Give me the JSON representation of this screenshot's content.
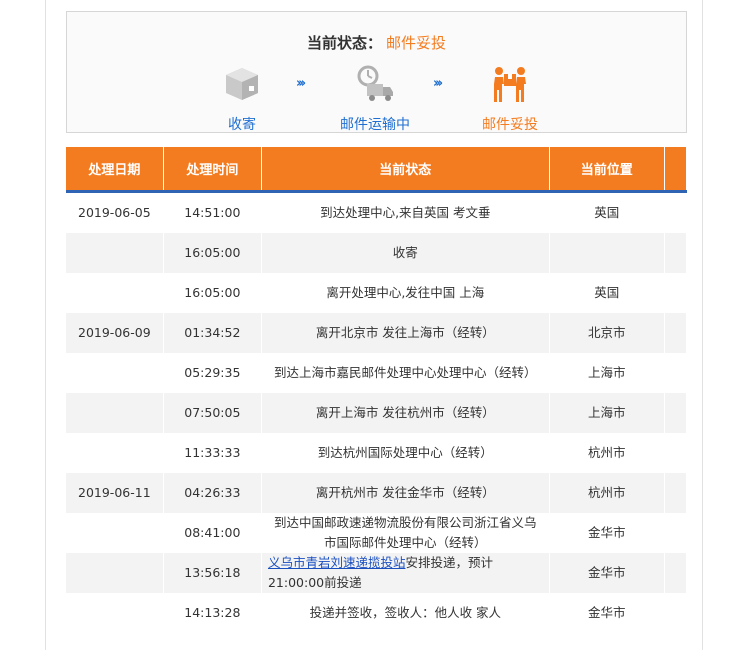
{
  "status": {
    "label": "当前状态：",
    "value": "邮件妥投",
    "steps": [
      {
        "label": "收寄",
        "icon": "package-box-icon",
        "color": "#1f6fd1"
      },
      {
        "label": "邮件运输中",
        "icon": "delivery-truck-icon",
        "color": "#1f6fd1"
      },
      {
        "label": "邮件妥投",
        "icon": "courier-delivery-icon",
        "color": "#f47c20"
      }
    ],
    "arrow": "›››"
  },
  "table": {
    "headers": [
      "处理日期",
      "处理时间",
      "当前状态",
      "当前位置"
    ],
    "rows": [
      {
        "date": "2019-06-05",
        "time": "14:51:00",
        "status": "到达处理中心,来自英国 考文垂",
        "location": "英国"
      },
      {
        "date": "",
        "time": "16:05:00",
        "status": "收寄",
        "location": ""
      },
      {
        "date": "",
        "time": "16:05:00",
        "status": "离开处理中心,发往中国 上海",
        "location": "英国"
      },
      {
        "date": "2019-06-09",
        "time": "01:34:52",
        "status": "离开北京市 发往上海市（经转）",
        "location": "北京市"
      },
      {
        "date": "",
        "time": "05:29:35",
        "status": "到达上海市嘉民邮件处理中心处理中心（经转）",
        "location": "上海市"
      },
      {
        "date": "",
        "time": "07:50:05",
        "status": "离开上海市 发往杭州市（经转）",
        "location": "上海市"
      },
      {
        "date": "",
        "time": "11:33:33",
        "status": "到达杭州国际处理中心（经转）",
        "location": "杭州市"
      },
      {
        "date": "2019-06-11",
        "time": "04:26:33",
        "status": "离开杭州市 发往金华市（经转）",
        "location": "杭州市"
      },
      {
        "date": "",
        "time": "08:41:00",
        "status": "到达中国邮政速递物流股份有限公司浙江省义乌市国际邮件处理中心（经转）",
        "location": "金华市"
      },
      {
        "date": "",
        "time": "13:56:18",
        "status_link": "义乌市青岩刘速递揽投站",
        "status": "安排投递，预计21:00:00前投递",
        "location": "金华市"
      },
      {
        "date": "",
        "time": "14:13:28",
        "status": "投递并签收，签收人：他人收 家人",
        "location": "金华市"
      }
    ]
  },
  "colors": {
    "accent": "#f47c20",
    "link": "#1f6fd1",
    "header_border": "#2f64b5"
  }
}
